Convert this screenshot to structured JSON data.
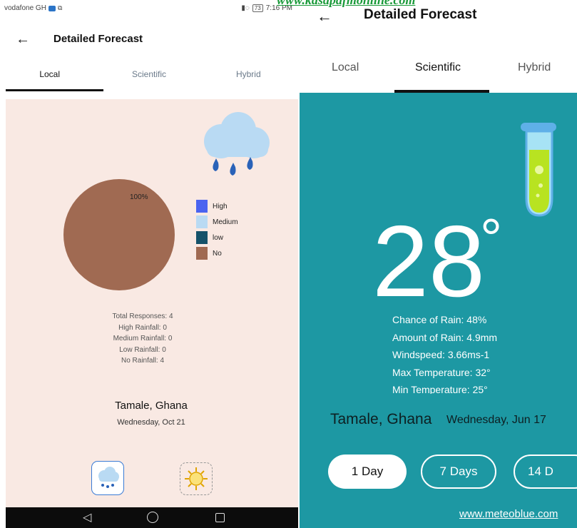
{
  "left_app": {
    "statusbar": {
      "carrier": "vodafone GH",
      "battery": "73",
      "time": "7:16 PM"
    },
    "header": {
      "title": "Detailed Forecast"
    },
    "tabs": [
      {
        "label": "Local",
        "active": true
      },
      {
        "label": "Scientific",
        "active": false
      },
      {
        "label": "Hybrid",
        "active": false
      }
    ],
    "chart_data": {
      "type": "pie",
      "slices": [
        {
          "name": "High",
          "value": 0,
          "color": "#4a63f0"
        },
        {
          "name": "Medium",
          "value": 0,
          "color": "#b9daf3"
        },
        {
          "name": "low",
          "value": 0,
          "color": "#15526a"
        },
        {
          "name": "No",
          "value": 100,
          "color": "#a06a52"
        }
      ],
      "data_labels": [
        "100%"
      ],
      "legend_position": "right"
    },
    "stats": {
      "total": "Total Responses: 4",
      "high": "High Rainfall: 0",
      "medium": "Medium Rainfall: 0",
      "low": "Low Rainfall: 0",
      "none": "No Rainfall: 4"
    },
    "location": "Tamale, Ghana",
    "date": "Wednesday, Oct 21",
    "icons": {
      "rain_button": "rain-cloud-icon",
      "sun_button": "sun-icon"
    },
    "colors": {
      "background": "#f9e9e3"
    }
  },
  "right_app": {
    "watermark": "www.kasapafmonline.com",
    "header": {
      "title": "Detailed Forecast"
    },
    "tabs": [
      {
        "label": "Local",
        "active": false
      },
      {
        "label": "Scientific",
        "active": true
      },
      {
        "label": "Hybrid",
        "active": false
      }
    ],
    "temperature": "28",
    "degree_symbol": "°",
    "details": [
      "Chance of Rain:  48%",
      "Amount of Rain:  4.9mm",
      "Windspeed:  3.66ms-1",
      "Max Temperature:  32°",
      "Min Temperature:  25°"
    ],
    "location": "Tamale, Ghana",
    "date": "Wednesday, Jun 17",
    "range_buttons": [
      {
        "label": "1 Day",
        "active": true
      },
      {
        "label": "7 Days",
        "active": false
      },
      {
        "label": "14 D",
        "active": false
      }
    ],
    "credit": "www.meteoblue.com",
    "colors": {
      "background": "#1d98a3",
      "flask_liquid": "#b8e321"
    }
  }
}
